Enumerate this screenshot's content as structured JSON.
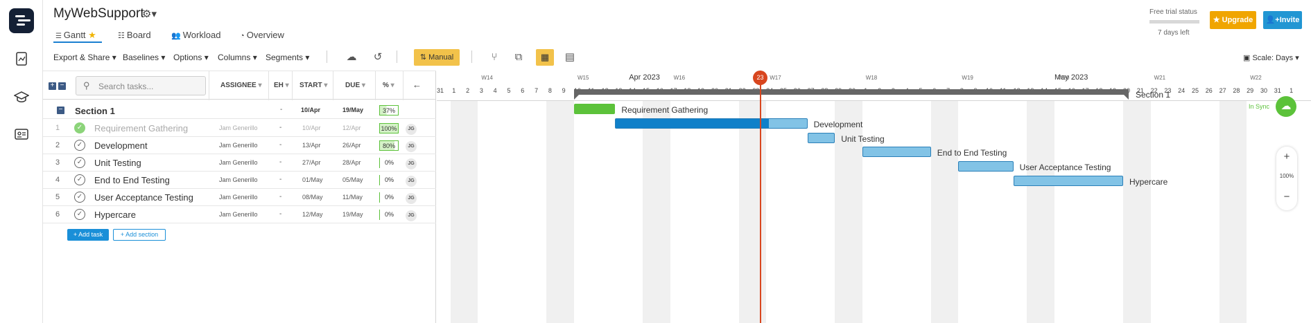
{
  "app": {
    "title": "MyWebSupport"
  },
  "nav": {
    "tabs": [
      "Gantt",
      "Board",
      "Workload",
      "Overview"
    ],
    "active": "Gantt"
  },
  "header_right": {
    "trial_status": "Free trial status",
    "days_left": "7 days left",
    "upgrade": "Upgrade",
    "invite": "Invite"
  },
  "toolbar": {
    "export": "Export & Share",
    "baselines": "Baselines",
    "options": "Options",
    "columns": "Columns",
    "segments": "Segments",
    "manual": "Manual",
    "scale": "Scale: Days"
  },
  "grid": {
    "search_placeholder": "Search tasks...",
    "columns": {
      "assignee": "ASSIGNEE",
      "eh": "EH",
      "start": "START",
      "due": "DUE",
      "pct": "%"
    },
    "section": {
      "name": "Section 1",
      "eh": "-",
      "start": "10/Apr",
      "due": "19/May",
      "pct": "37%"
    },
    "tasks": [
      {
        "num": "1",
        "name": "Requirement Gathering",
        "assignee": "Jam Generillo",
        "eh": "-",
        "start": "10/Apr",
        "due": "12/Apr",
        "pct": "100%",
        "initials": "JG",
        "done": true
      },
      {
        "num": "2",
        "name": "Development",
        "assignee": "Jam Generillo",
        "eh": "-",
        "start": "13/Apr",
        "due": "26/Apr",
        "pct": "80%",
        "initials": "JG",
        "done": false
      },
      {
        "num": "3",
        "name": "Unit Testing",
        "assignee": "Jam Generillo",
        "eh": "-",
        "start": "27/Apr",
        "due": "28/Apr",
        "pct": "0%",
        "initials": "JG",
        "done": false
      },
      {
        "num": "4",
        "name": "End to End Testing",
        "assignee": "Jam Generillo",
        "eh": "-",
        "start": "01/May",
        "due": "05/May",
        "pct": "0%",
        "initials": "JG",
        "done": false
      },
      {
        "num": "5",
        "name": "User Acceptance Testing",
        "assignee": "Jam Generillo",
        "eh": "-",
        "start": "08/May",
        "due": "11/May",
        "pct": "0%",
        "initials": "JG",
        "done": false
      },
      {
        "num": "6",
        "name": "Hypercare",
        "assignee": "Jam Generillo",
        "eh": "-",
        "start": "12/May",
        "due": "19/May",
        "pct": "0%",
        "initials": "JG",
        "done": false
      }
    ],
    "add_task": "Add task",
    "add_section": "Add section"
  },
  "timeline": {
    "months": [
      "Apr 2023",
      "May 2023"
    ],
    "weeks": [
      "W14",
      "W15",
      "W16",
      "W17",
      "W18",
      "W19",
      "W20",
      "W21",
      "W22"
    ],
    "days": [
      "31",
      "1",
      "2",
      "3",
      "4",
      "5",
      "6",
      "7",
      "8",
      "9",
      "10",
      "11",
      "12",
      "13",
      "14",
      "15",
      "16",
      "17",
      "18",
      "19",
      "20",
      "21",
      "22",
      "23",
      "24",
      "25",
      "26",
      "27",
      "28",
      "29",
      "30",
      "1",
      "2",
      "3",
      "4",
      "5",
      "6",
      "7",
      "8",
      "9",
      "10",
      "11",
      "12",
      "13",
      "14",
      "15",
      "16",
      "17",
      "18",
      "19",
      "20",
      "21",
      "22",
      "23",
      "24",
      "25",
      "26",
      "27",
      "28",
      "29",
      "30",
      "31",
      "1"
    ],
    "today_label": "23",
    "section_bar_label": "Section 1",
    "status": "In Sync",
    "zoom": "100%"
  },
  "colors": {
    "accent": "#1a8fd8",
    "bar": "#82c3e6",
    "bar_progress": "#1080c9",
    "done": "#5cc23a",
    "today": "#d8461f",
    "manual": "#f2c24a"
  }
}
